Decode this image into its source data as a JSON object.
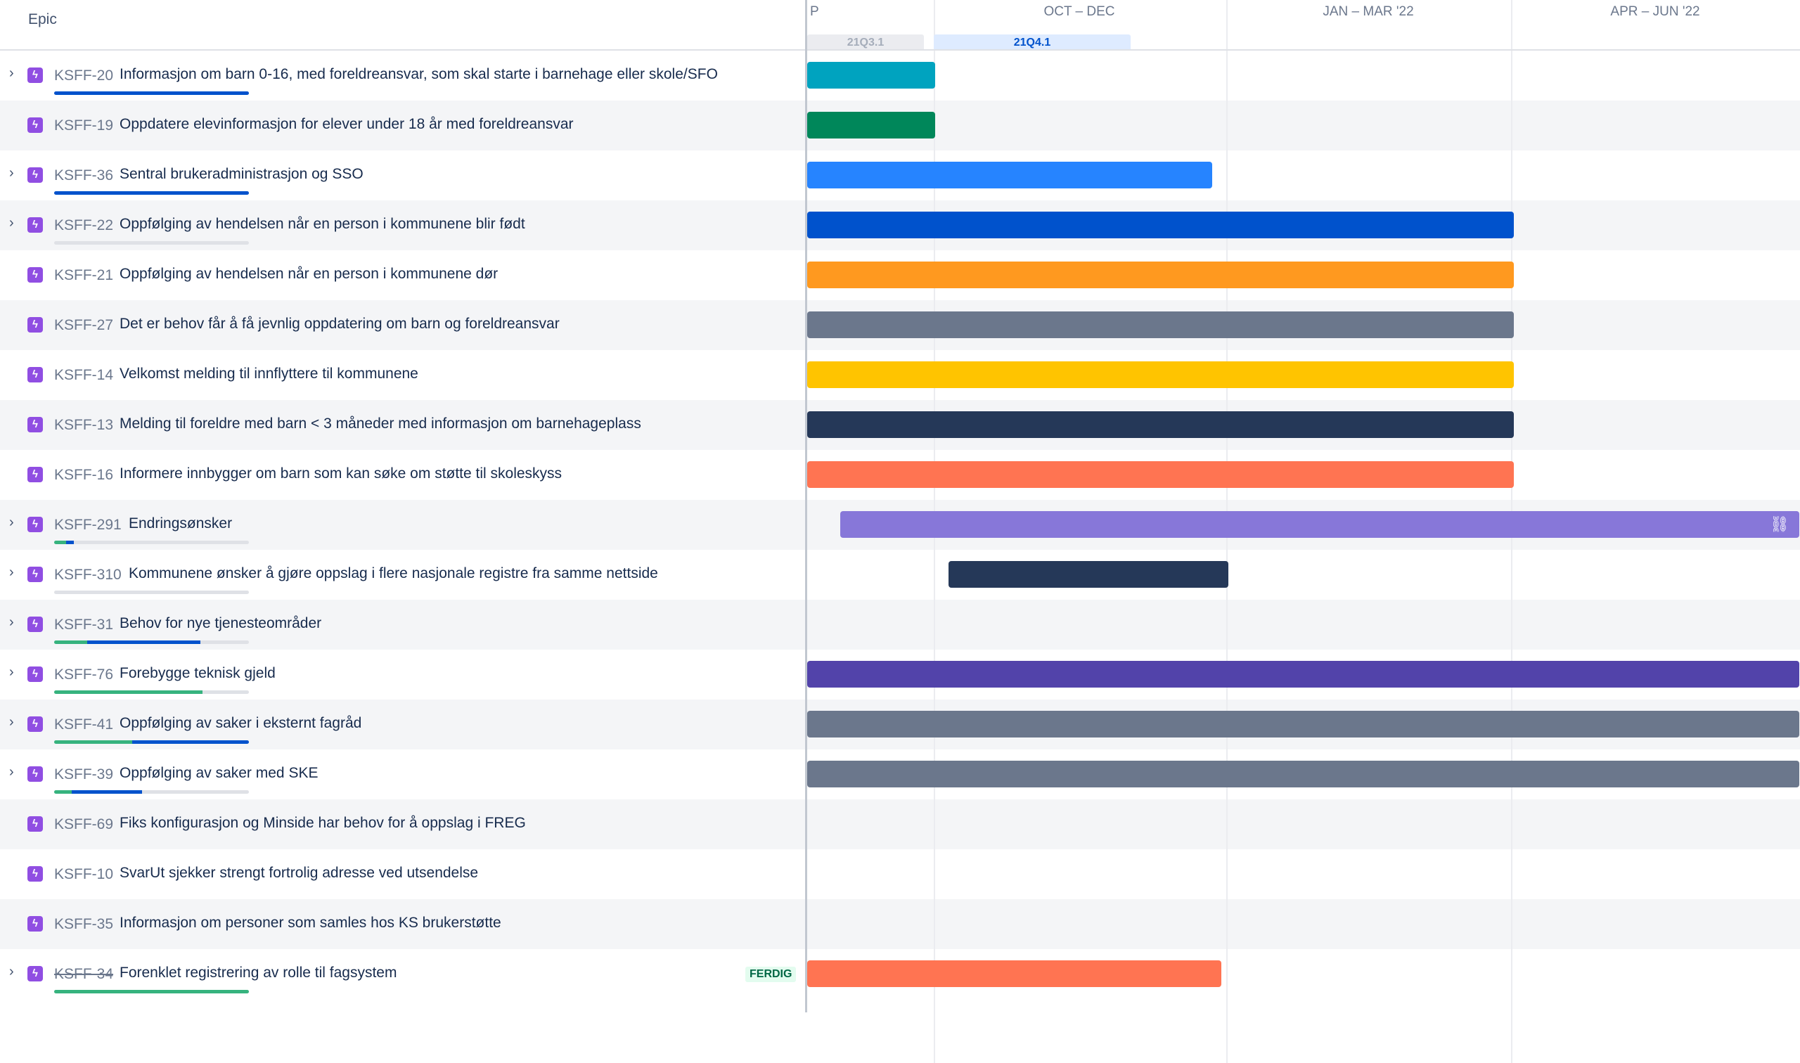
{
  "header": {
    "column_title": "Epic"
  },
  "timeline": {
    "months": [
      "P",
      "OCT – DEC",
      "JAN – MAR '22",
      "APR – JUN '22"
    ],
    "sprints": [
      {
        "label": "21Q3.1",
        "state": "past"
      },
      {
        "label": "21Q4.1",
        "state": "current"
      }
    ]
  },
  "epics": [
    {
      "key": "KSFF-20",
      "summary": "Informasjon om barn 0-16, med foreldreansvar, som skal starte i barnehage eller skole/SFO",
      "expandable": true,
      "done": false,
      "color": "#00a3bf",
      "start": 0,
      "end": 0.129,
      "progress": {
        "done": 0,
        "in_progress": 1
      }
    },
    {
      "key": "KSFF-19",
      "summary": "Oppdatere elevinformasjon for elever under 18 år med foreldreansvar",
      "expandable": false,
      "done": false,
      "color": "#00875a",
      "start": 0,
      "end": 0.129
    },
    {
      "key": "KSFF-36",
      "summary": "Sentral brukeradministrasjon og SSO",
      "expandable": true,
      "done": false,
      "color": "#2684ff",
      "start": 0,
      "end": 0.408,
      "progress": {
        "done": 0,
        "in_progress": 1
      }
    },
    {
      "key": "KSFF-22",
      "summary": "Oppfølging av hendelsen når en person i kommunene blir født",
      "expandable": true,
      "done": false,
      "color": "#0052cc",
      "start": 0,
      "end": 0.712,
      "progress": {
        "done": 0,
        "in_progress": 0
      }
    },
    {
      "key": "KSFF-21",
      "summary": "Oppfølging av hendelsen når en person i kommunene dør",
      "expandable": false,
      "done": false,
      "color": "#ff991f",
      "start": 0,
      "end": 0.712
    },
    {
      "key": "KSFF-27",
      "summary": "Det er behov får å få jevnlig oppdatering om barn og foreldreansvar",
      "expandable": false,
      "done": false,
      "color": "#6b778c",
      "start": 0,
      "end": 0.712
    },
    {
      "key": "KSFF-14",
      "summary": "Velkomst melding til innflyttere til kommunene",
      "expandable": false,
      "done": false,
      "color": "#ffc400",
      "start": 0,
      "end": 0.712
    },
    {
      "key": "KSFF-13",
      "summary": "Melding til foreldre med barn < 3 måneder med informasjon om barnehageplass",
      "expandable": false,
      "done": false,
      "color": "#253858",
      "start": 0,
      "end": 0.712
    },
    {
      "key": "KSFF-16",
      "summary": "Informere innbygger om barn som kan søke om støtte til skoleskyss",
      "expandable": false,
      "done": false,
      "color": "#ff7452",
      "start": 0,
      "end": 0.712
    },
    {
      "key": "KSFF-291",
      "summary": "Endringsønsker",
      "expandable": true,
      "done": false,
      "color": "#8777d9",
      "start": 0.033,
      "end": 1,
      "link": true,
      "progress": {
        "done": 0.06,
        "in_progress": 0.04
      }
    },
    {
      "key": "KSFF-310",
      "summary": "Kommunene ønsker å gjøre oppslag i flere nasjonale registre fra samme nettside",
      "expandable": true,
      "done": false,
      "color": "#253858",
      "start": 0.142,
      "end": 0.424,
      "progress": {
        "done": 0,
        "in_progress": 0
      }
    },
    {
      "key": "KSFF-31",
      "summary": "Behov for nye tjenesteområder",
      "expandable": true,
      "done": false,
      "progress": {
        "done": 0.17,
        "in_progress": 0.58
      }
    },
    {
      "key": "KSFF-76",
      "summary": "Forebygge teknisk gjeld",
      "expandable": true,
      "done": false,
      "color": "#5243aa",
      "start": 0,
      "end": 1,
      "progress": {
        "done": 0.76,
        "in_progress": 0
      }
    },
    {
      "key": "KSFF-41",
      "summary": "Oppfølging av saker i eksternt fagråd",
      "expandable": true,
      "done": false,
      "color": "#6b778c",
      "start": 0,
      "end": 1,
      "progress": {
        "done": 0.4,
        "in_progress": 0.6
      }
    },
    {
      "key": "KSFF-39",
      "summary": "Oppfølging av saker med SKE",
      "expandable": true,
      "done": false,
      "color": "#6b778c",
      "start": 0,
      "end": 1,
      "progress": {
        "done": 0.09,
        "in_progress": 0.36
      }
    },
    {
      "key": "KSFF-69",
      "summary": "Fiks konfigurasjon og Minside har behov for å oppslag i FREG",
      "expandable": false,
      "done": false
    },
    {
      "key": "KSFF-10",
      "summary": "SvarUt sjekker strengt fortrolig adresse ved utsendelse",
      "expandable": false,
      "done": false
    },
    {
      "key": "KSFF-35",
      "summary": "Informasjon om personer som samles hos KS brukerstøtte",
      "expandable": false,
      "done": false
    },
    {
      "key": "KSFF-34",
      "summary": "Forenklet registrering av rolle til fagsystem",
      "expandable": true,
      "done": true,
      "status": "FERDIG",
      "color": "#ff7452",
      "start": 0,
      "end": 0.417,
      "progress": {
        "done": 1,
        "in_progress": 0
      }
    }
  ]
}
